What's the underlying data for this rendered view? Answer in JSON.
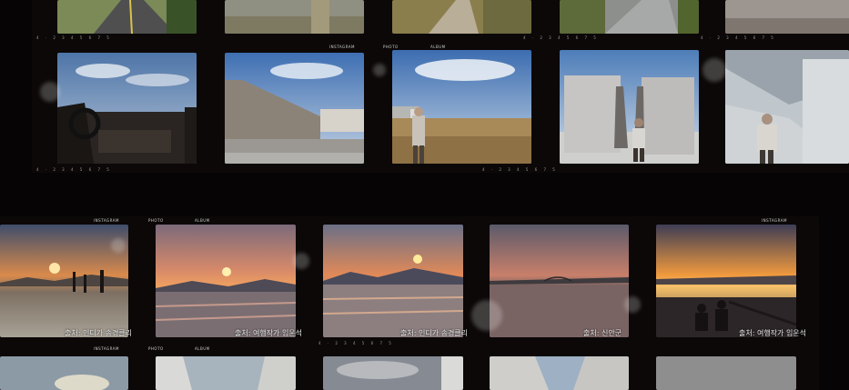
{
  "edge_labels": {
    "instagram": "INSTAGRAM",
    "photo": "PHOTO",
    "album": "ALBUM"
  },
  "sprocket_text": "4 · 2 3 4 5 6 7 5",
  "captions": [
    "출처: 인디가 송경클리",
    "출처: 여행작가 임운석",
    "출처: 인디가 송경클리",
    "출처: 신안군",
    "출처: 여행작가 임운석"
  ],
  "colors": {
    "film_base": "#0c0808",
    "background": "#050303"
  }
}
